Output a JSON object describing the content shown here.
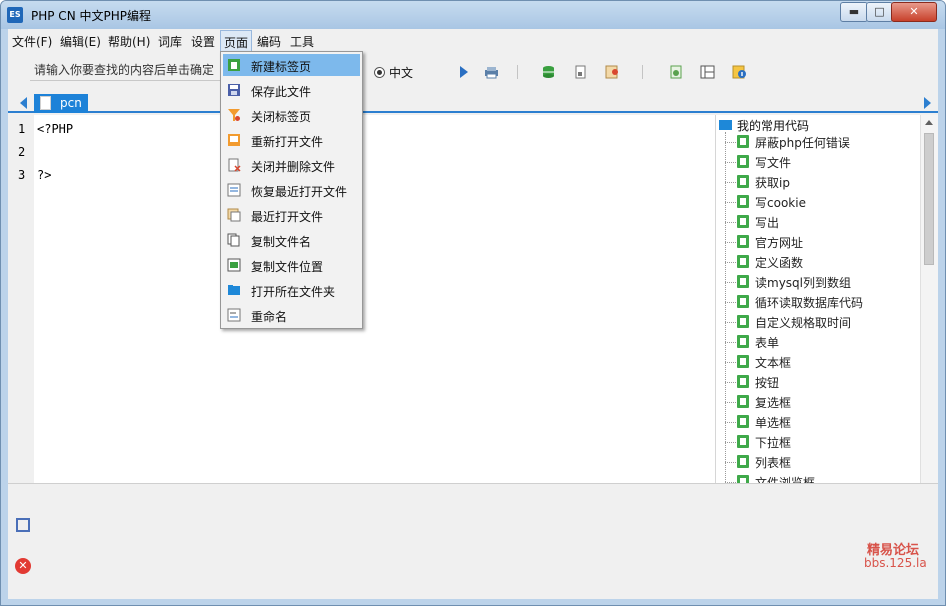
{
  "window": {
    "title": "PHP CN 中文PHP编程",
    "app_icon_text": "ES",
    "minimize_glyph": "▬",
    "maximize_glyph": "□",
    "close_glyph": "✕"
  },
  "menubar": {
    "items": [
      {
        "label": "文件(F)"
      },
      {
        "label": "编辑(E)"
      },
      {
        "label": "帮助(H)"
      },
      {
        "label": "词库"
      },
      {
        "label": "设置"
      },
      {
        "label": "页面"
      },
      {
        "label": "编码"
      },
      {
        "label": "工具"
      }
    ],
    "open_menu": "页面"
  },
  "toolbar": {
    "search_placeholder": "请输入你要查找的内容后单击确定",
    "radio_label": "中文"
  },
  "tabs": [
    {
      "label": "pcn"
    }
  ],
  "editor": {
    "line_numbers": [
      "1",
      "2",
      "3"
    ],
    "lines": [
      "<?PHP",
      "",
      "?>"
    ]
  },
  "tree": {
    "root": "我的常用代码",
    "items": [
      "屏蔽php任何错误",
      "写文件",
      "获取ip",
      "写cookie",
      "写出",
      "官方网址",
      "定义函数",
      "读mysql列到数组",
      "循环读取数据库代码",
      "自定义规格取时间",
      "表单",
      "文本框",
      "按钮",
      "复选框",
      "单选框",
      "下拉框",
      "列表框",
      "文件浏览框"
    ]
  },
  "dropdown": {
    "items": [
      {
        "label": "新建标签页",
        "icon": "new-tab-icon",
        "highlighted": true
      },
      {
        "label": "保存此文件",
        "icon": "save-icon"
      },
      {
        "label": "关闭标签页",
        "icon": "close-tab-icon"
      },
      {
        "label": "重新打开文件",
        "icon": "reopen-file-icon"
      },
      {
        "label": "关闭并删除文件",
        "icon": "delete-file-icon"
      },
      {
        "label": "恢复最近打开文件",
        "icon": "restore-file-icon"
      },
      {
        "label": "最近打开文件",
        "icon": "recent-files-icon"
      },
      {
        "label": "复制文件名",
        "icon": "copy-filename-icon"
      },
      {
        "label": "复制文件位置",
        "icon": "copy-path-icon"
      },
      {
        "label": "打开所在文件夹",
        "icon": "folder-icon"
      },
      {
        "label": "重命名",
        "icon": "rename-icon"
      }
    ]
  },
  "watermark": {
    "line1": "精易论坛",
    "line2": "bbs.125.la"
  },
  "colors": {
    "accent": "#1d82d8",
    "menu_highlight": "#7db9ec",
    "tree_leaf": "#3fa94a",
    "close_button": "#c7412b"
  }
}
